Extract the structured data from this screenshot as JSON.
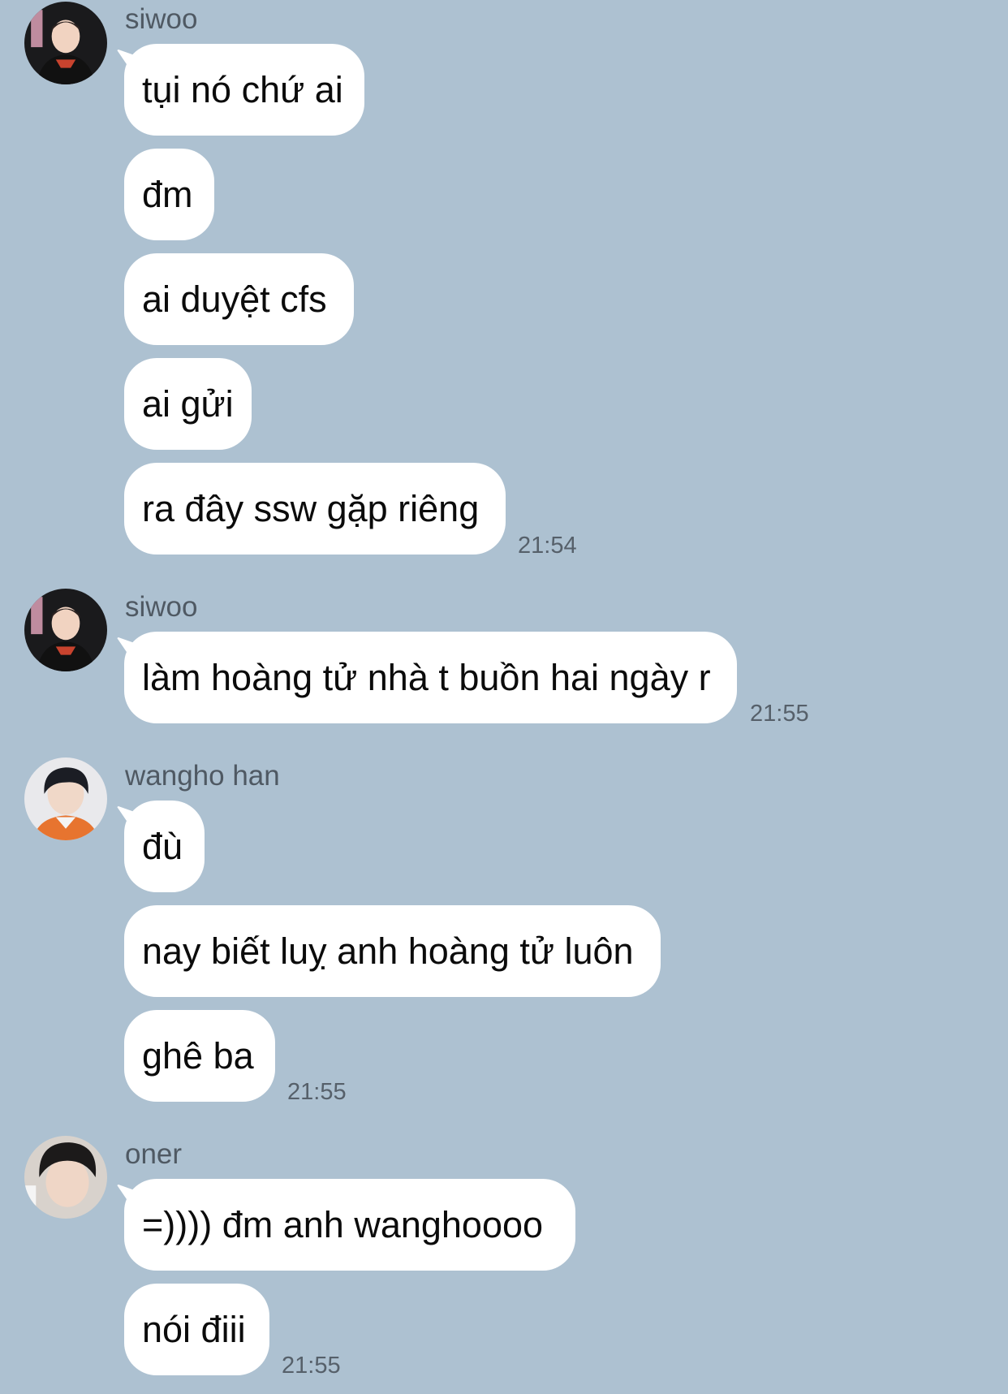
{
  "colors": {
    "background": "#adc1d1",
    "bubble": "#ffffff",
    "sender_text": "#4f5963",
    "timestamp_text": "#56606a"
  },
  "groups": [
    {
      "sender": "siwoo",
      "avatar": "siwoo-avatar",
      "messages": [
        "tụi nó chứ ai",
        "đm",
        "ai duyệt cfs",
        "ai gửi",
        "ra đây ssw gặp riêng"
      ],
      "time": "21:54"
    },
    {
      "sender": "siwoo",
      "avatar": "siwoo-avatar",
      "messages": [
        "làm hoàng tử nhà t buồn hai ngày r"
      ],
      "time": "21:55"
    },
    {
      "sender": "wangho han",
      "avatar": "wangho-avatar",
      "messages": [
        "đù",
        "nay biết luỵ anh hoàng tử luôn",
        "ghê ba"
      ],
      "time": "21:55"
    },
    {
      "sender": "oner",
      "avatar": "oner-avatar",
      "messages": [
        "=)))) đm anh wanghoooo",
        "nói điii"
      ],
      "time": "21:55"
    }
  ]
}
